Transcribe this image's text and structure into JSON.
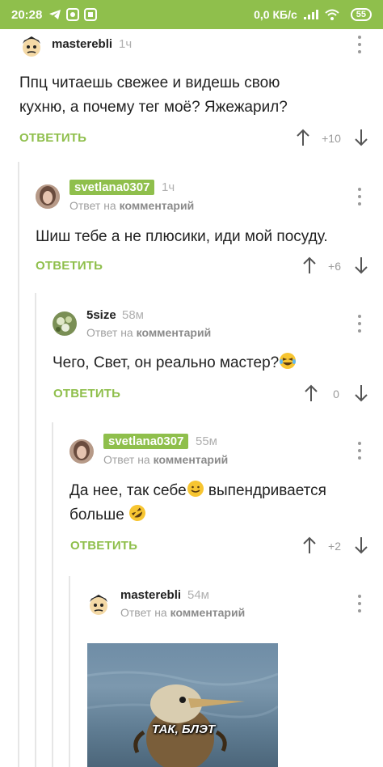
{
  "status_bar": {
    "time": "20:28",
    "network_speed": "0,0 КБ/с",
    "battery": "55",
    "icons": [
      "telegram-icon",
      "app-icon",
      "app-icon",
      "signal-icon",
      "wifi-icon",
      "battery-icon"
    ]
  },
  "colors": {
    "accent": "#8fbf4c",
    "muted": "#a0a0a0",
    "text": "#222222"
  },
  "comments": [
    {
      "author": "masterebli",
      "time": "1ч",
      "reply_to": "",
      "text_lines": [
        "Ппц читаешь свежее и видешь свою",
        "кухню, а почему тег моё? Яжежарил?"
      ],
      "reply_label": "ОТВЕТИТЬ",
      "rating": "+10"
    },
    {
      "author": "svetlana0307",
      "time": "1ч",
      "reply_to": "Ответ на комментарий",
      "reply_prefix": "Ответ на",
      "reply_word": "комментарий",
      "text_lines": [
        "Шиш тебе а не плюсики, иди мой посуду."
      ],
      "reply_label": "ОТВЕТИТЬ",
      "rating": "+6"
    },
    {
      "author": "5size",
      "time": "58м",
      "reply_prefix": "Ответ на",
      "reply_word": "комментарий",
      "text_lines": [
        "Чего, Свет, он реально мастер?"
      ],
      "reply_label": "ОТВЕТИТЬ",
      "rating": "0"
    },
    {
      "author": "svetlana0307",
      "time": "55м",
      "reply_prefix": "Ответ на",
      "reply_word": "комментарий",
      "text_lines": [
        "Да нее, так себе",
        "выпендривается",
        "больше"
      ],
      "reply_label": "ОТВЕТИТЬ",
      "rating": "+2"
    },
    {
      "author": "masterebli",
      "time": "54м",
      "reply_prefix": "Ответ на",
      "reply_word": "комментарий",
      "image_caption": "ТАК, БЛЭТ"
    }
  ]
}
